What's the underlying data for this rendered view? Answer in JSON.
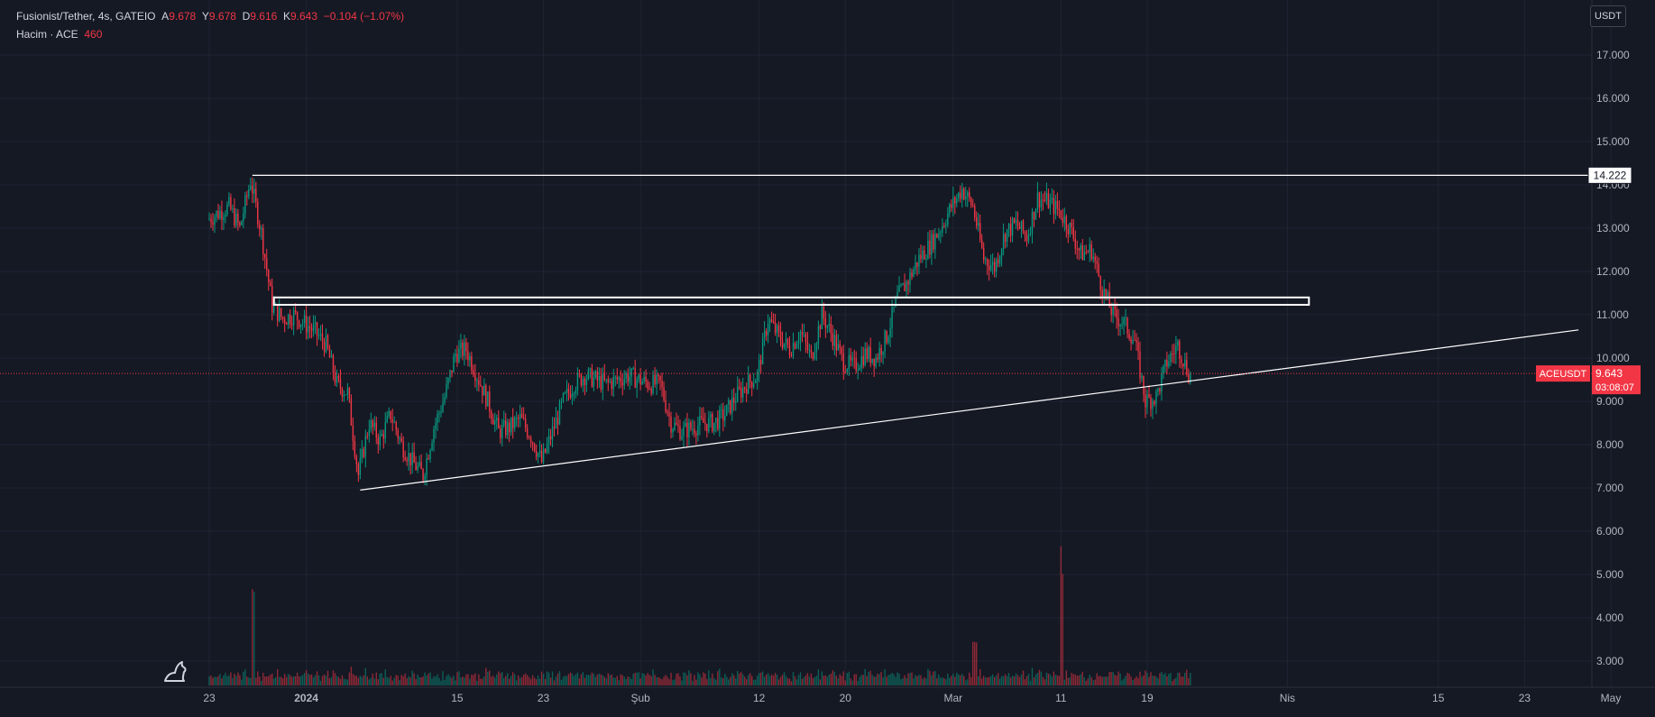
{
  "legend": {
    "symbol": "Fusionist/Tether, 4s, GATEIO",
    "open_label": "A",
    "open": "9.678",
    "high_label": "Y",
    "high": "9.678",
    "low_label": "D",
    "low": "9.616",
    "close_label": "K",
    "close": "9.643",
    "change": "−0.104 (−1.07%)",
    "volume_label": "Hacim · ACE",
    "volume": "460"
  },
  "currency_button": "USDT",
  "colors": {
    "up": "#089981",
    "down": "#f23645",
    "background": "#151924",
    "grid": "#1f2433",
    "text": "#d1d4dc",
    "drawing": "#ffffff"
  },
  "price_tag": {
    "symbol": "ACEUSDT",
    "price": "9.643",
    "countdown": "03:08:07"
  },
  "resistance_label": "14.222",
  "chart_data": {
    "type": "candlestick",
    "y_ticks": [
      "17.000",
      "16.000",
      "15.000",
      "14.000",
      "13.000",
      "12.000",
      "11.000",
      "10.000",
      "9.000",
      "8.000",
      "7.000",
      "6.000",
      "5.000",
      "4.000",
      "3.000"
    ],
    "ylim": [
      2.6,
      17.6
    ],
    "x_ticks": [
      {
        "label": "23",
        "date": "2023-12-23"
      },
      {
        "label": "2024",
        "date": "2024-01-01",
        "bold": true
      },
      {
        "label": "15",
        "date": "2024-01-15"
      },
      {
        "label": "23",
        "date": "2024-01-23"
      },
      {
        "label": "Şub",
        "date": "2024-02-01"
      },
      {
        "label": "12",
        "date": "2024-02-12"
      },
      {
        "label": "20",
        "date": "2024-02-20"
      },
      {
        "label": "Mar",
        "date": "2024-03-01"
      },
      {
        "label": "11",
        "date": "2024-03-11"
      },
      {
        "label": "19",
        "date": "2024-03-19"
      },
      {
        "label": "Nis",
        "date": "2024-04-01"
      },
      {
        "label": "15",
        "date": "2024-04-15"
      },
      {
        "label": "23",
        "date": "2024-04-23"
      },
      {
        "label": "May",
        "date": "2024-05-01"
      }
    ],
    "xlim": [
      "2023-12-23",
      "2024-05-01"
    ],
    "price_path": [
      [
        "2023-12-23",
        13.2
      ],
      [
        "2023-12-25",
        13.5
      ],
      [
        "2023-12-26",
        13.0
      ],
      [
        "2023-12-27",
        14.1
      ],
      [
        "2023-12-28",
        12.9
      ],
      [
        "2023-12-29",
        11.2
      ],
      [
        "2023-12-30",
        10.9
      ],
      [
        "2023-12-31",
        11.0
      ],
      [
        "2024-01-01",
        10.8
      ],
      [
        "2024-01-02",
        10.6
      ],
      [
        "2024-01-03",
        10.3
      ],
      [
        "2024-01-04",
        9.4
      ],
      [
        "2024-01-05",
        9.2
      ],
      [
        "2024-01-06",
        7.3
      ],
      [
        "2024-01-07",
        8.5
      ],
      [
        "2024-01-08",
        8.1
      ],
      [
        "2024-01-09",
        8.7
      ],
      [
        "2024-01-10",
        8.0
      ],
      [
        "2024-01-11",
        7.6
      ],
      [
        "2024-01-12",
        7.3
      ],
      [
        "2024-01-13",
        8.4
      ],
      [
        "2024-01-14",
        9.1
      ],
      [
        "2024-01-15",
        10.1
      ],
      [
        "2024-01-16",
        10.2
      ],
      [
        "2024-01-17",
        9.6
      ],
      [
        "2024-01-18",
        9.0
      ],
      [
        "2024-01-19",
        8.3
      ],
      [
        "2024-01-20",
        8.4
      ],
      [
        "2024-01-21",
        8.6
      ],
      [
        "2024-01-22",
        8.2
      ],
      [
        "2024-01-23",
        7.6
      ],
      [
        "2024-01-24",
        8.3
      ],
      [
        "2024-01-25",
        9.0
      ],
      [
        "2024-01-26",
        9.4
      ],
      [
        "2024-01-27",
        9.6
      ],
      [
        "2024-01-28",
        9.5
      ],
      [
        "2024-01-29",
        9.4
      ],
      [
        "2024-01-30",
        9.5
      ],
      [
        "2024-01-31",
        9.6
      ],
      [
        "2024-02-01",
        9.5
      ],
      [
        "2024-02-02",
        9.4
      ],
      [
        "2024-02-03",
        9.4
      ],
      [
        "2024-02-04",
        8.5
      ],
      [
        "2024-02-05",
        8.3
      ],
      [
        "2024-02-06",
        8.4
      ],
      [
        "2024-02-07",
        8.5
      ],
      [
        "2024-02-08",
        8.5
      ],
      [
        "2024-02-09",
        8.7
      ],
      [
        "2024-02-10",
        9.1
      ],
      [
        "2024-02-11",
        9.4
      ],
      [
        "2024-02-12",
        9.6
      ],
      [
        "2024-02-13",
        10.9
      ],
      [
        "2024-02-14",
        10.5
      ],
      [
        "2024-02-15",
        10.2
      ],
      [
        "2024-02-16",
        10.6
      ],
      [
        "2024-02-17",
        10.0
      ],
      [
        "2024-02-18",
        11.0
      ],
      [
        "2024-02-19",
        10.5
      ],
      [
        "2024-02-20",
        9.9
      ],
      [
        "2024-02-21",
        9.8
      ],
      [
        "2024-02-22",
        10.1
      ],
      [
        "2024-02-23",
        10.0
      ],
      [
        "2024-02-24",
        10.5
      ],
      [
        "2024-02-25",
        11.4
      ],
      [
        "2024-02-26",
        11.8
      ],
      [
        "2024-02-27",
        12.3
      ],
      [
        "2024-02-28",
        12.6
      ],
      [
        "2024-02-29",
        13.0
      ],
      [
        "2024-03-01",
        13.5
      ],
      [
        "2024-03-02",
        13.9
      ],
      [
        "2024-03-03",
        13.5
      ],
      [
        "2024-03-04",
        12.3
      ],
      [
        "2024-03-05",
        12.1
      ],
      [
        "2024-03-06",
        12.9
      ],
      [
        "2024-03-07",
        13.1
      ],
      [
        "2024-03-08",
        12.8
      ],
      [
        "2024-03-09",
        13.7
      ],
      [
        "2024-03-10",
        13.6
      ],
      [
        "2024-03-11",
        13.4
      ],
      [
        "2024-03-12",
        13.0
      ],
      [
        "2024-03-13",
        12.4
      ],
      [
        "2024-03-14",
        12.5
      ],
      [
        "2024-03-15",
        11.6
      ],
      [
        "2024-03-16",
        11.0
      ],
      [
        "2024-03-17",
        10.8
      ],
      [
        "2024-03-18",
        10.4
      ],
      [
        "2024-03-19",
        9.0
      ],
      [
        "2024-03-20",
        9.1
      ],
      [
        "2024-03-21",
        9.9
      ],
      [
        "2024-03-22",
        10.3
      ],
      [
        "2024-03-23",
        9.643
      ]
    ],
    "resistance": {
      "price": 14.222,
      "from": "2023-12-27"
    },
    "zone": {
      "from": "2023-12-29",
      "to": "2024-04-03",
      "top": 11.4,
      "bottom": 11.23
    },
    "trendline": {
      "from_date": "2024-01-06",
      "from_price": 6.95,
      "to_date": "2024-04-28",
      "to_price": 10.65
    },
    "current_price": 9.643,
    "volume_peaks": [
      {
        "date": "2023-12-27",
        "value": 820
      },
      {
        "date": "2024-01-07",
        "value": 180
      },
      {
        "date": "2024-03-03",
        "value": 260
      },
      {
        "date": "2024-03-11",
        "value": 720
      }
    ]
  }
}
